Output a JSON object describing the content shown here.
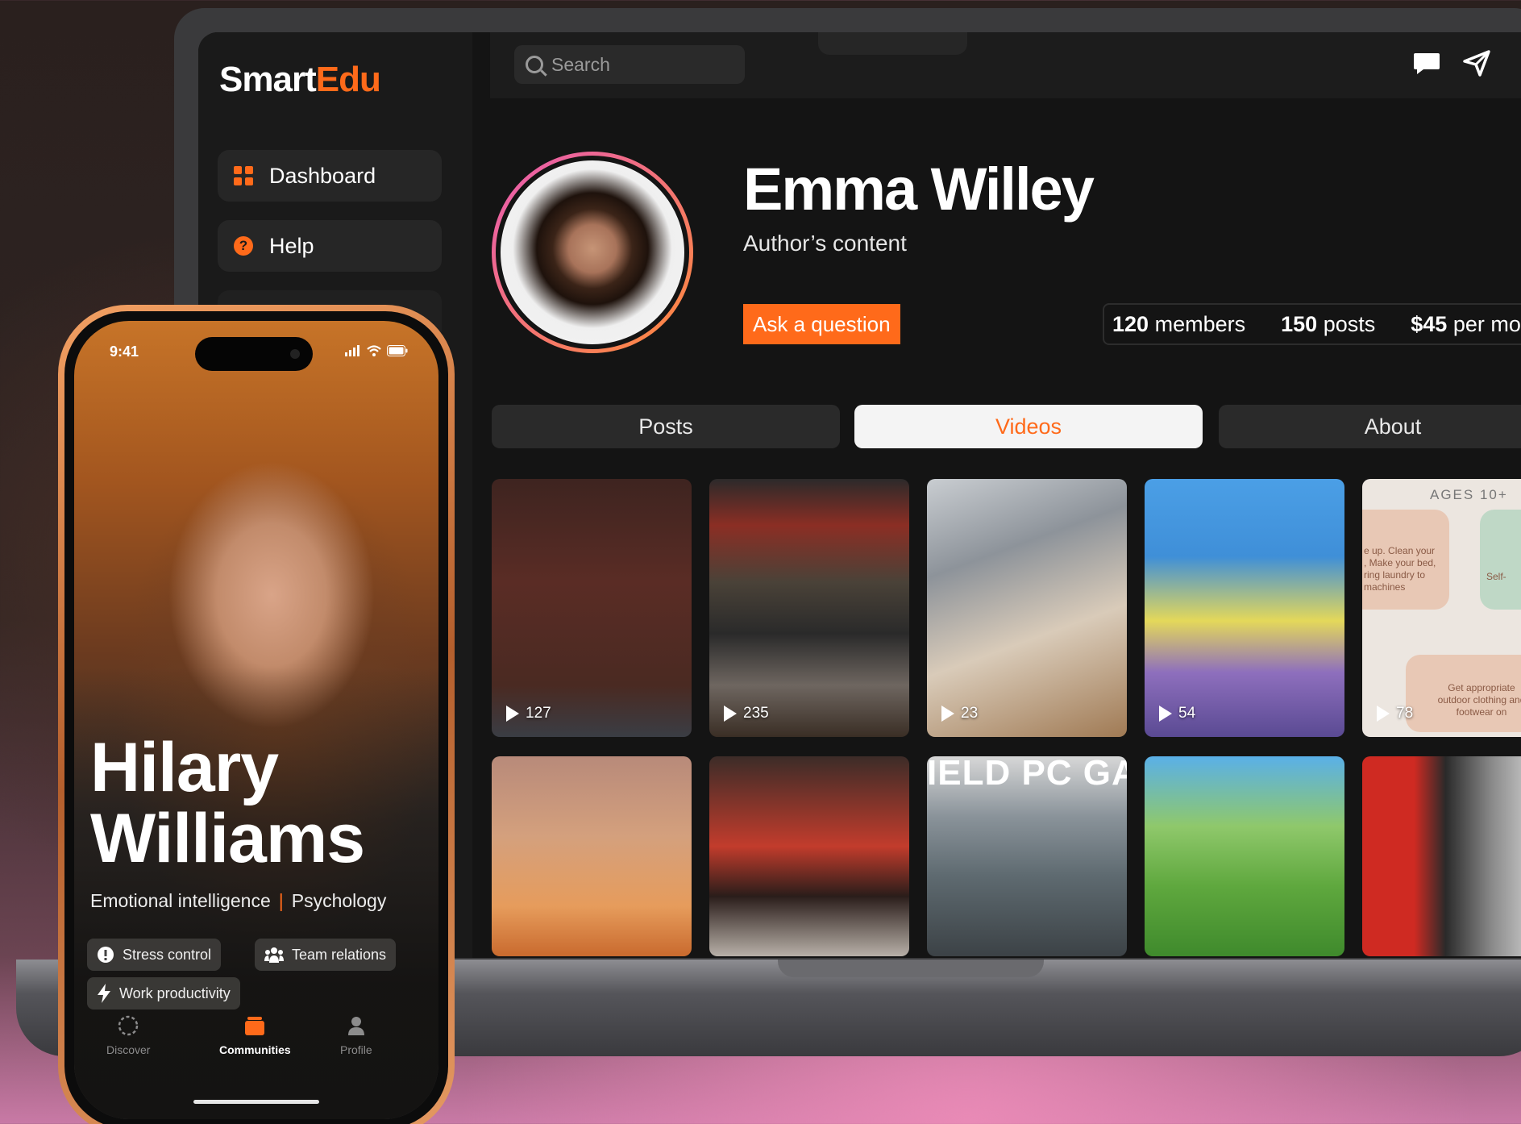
{
  "app": {
    "logo_smart": "Smart",
    "logo_edu": "Edu"
  },
  "sidebar": {
    "items": [
      {
        "label": "Dashboard",
        "icon": "dashboard-icon"
      },
      {
        "label": "Help",
        "icon": "help-icon"
      }
    ]
  },
  "search": {
    "placeholder": "Search"
  },
  "topbar_icons": [
    "chat-icon",
    "send-icon"
  ],
  "profile": {
    "name": "Emma Willey",
    "subtitle": "Author’s content",
    "ask_button": "Ask a question",
    "stats": [
      {
        "value": "120",
        "label": "members"
      },
      {
        "value": "150",
        "label": "posts"
      },
      {
        "value": "$45",
        "label": "per mo"
      }
    ]
  },
  "tabs": [
    {
      "label": "Posts",
      "active": false
    },
    {
      "label": "Videos",
      "active": true
    },
    {
      "label": "About",
      "active": false
    }
  ],
  "videos": [
    {
      "count": "127"
    },
    {
      "count": "235"
    },
    {
      "count": "23"
    },
    {
      "count": "54"
    },
    {
      "count": "78"
    },
    {
      "count": ""
    },
    {
      "count": ""
    },
    {
      "count": ""
    },
    {
      "count": ""
    },
    {
      "count": ""
    }
  ],
  "video_texts": {
    "ages": "AGES 10+",
    "card_a": "e up. Clean your\n, Make your bed,\nring laundry to\nmachines",
    "card_b": "Self-",
    "card_c": "Get appropriate\noutdoor clothing and\nfootwear on",
    "game_banner": "IELD PC GAM"
  },
  "phone": {
    "time": "9:41",
    "name_line1": "Hilary",
    "name_line2": "Williams",
    "tags": [
      "Emotional intelligence",
      "Psychology"
    ],
    "tag_separator": "|",
    "chips": [
      {
        "label": "Stress control",
        "icon": "alert-icon"
      },
      {
        "label": "Team relations",
        "icon": "team-icon"
      },
      {
        "label": "Work productivity",
        "icon": "bolt-icon"
      }
    ],
    "nav": [
      {
        "label": "Discover",
        "active": false
      },
      {
        "label": "Communities",
        "active": true
      },
      {
        "label": "Profile",
        "active": false
      }
    ]
  },
  "colors": {
    "accent": "#ff6a1a",
    "ring_start": "#e85ab4",
    "ring_end": "#ff8c38"
  }
}
